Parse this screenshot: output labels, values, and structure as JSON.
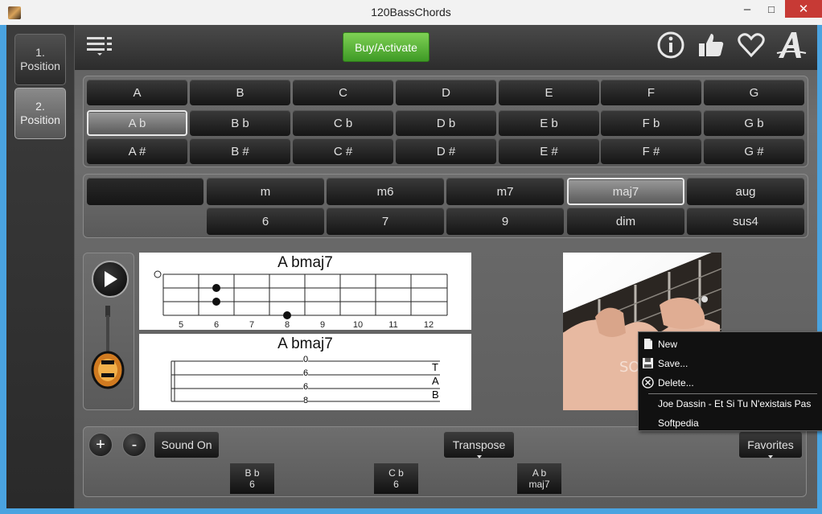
{
  "window": {
    "title": "120BassChords",
    "minimize": "–",
    "maximize": "□",
    "close": "✕"
  },
  "positions": [
    {
      "label_line1": "1.",
      "label_line2": "Position"
    },
    {
      "label_line1": "2.",
      "label_line2": "Position"
    }
  ],
  "toolbar": {
    "buy_label": "Buy/Activate",
    "icons": [
      "info-icon",
      "thumbs-up-icon",
      "heart-icon",
      "font-icon"
    ]
  },
  "notes": {
    "row1": [
      "A",
      "B",
      "C",
      "D",
      "E",
      "F",
      "G"
    ],
    "row2": [
      "A b",
      "B b",
      "C b",
      "D b",
      "E b",
      "F b",
      "G b"
    ],
    "row3": [
      "A #",
      "B #",
      "C #",
      "D #",
      "E #",
      "F #",
      "G #"
    ],
    "selected": "A b"
  },
  "chord_types": {
    "row1": [
      "m",
      "m6",
      "m7",
      "maj7",
      "aug"
    ],
    "row2": [
      "6",
      "7",
      "9",
      "dim",
      "sus4"
    ],
    "selected": "maj7"
  },
  "chord": {
    "fretboard_title": "A bmaj7",
    "fret_numbers": [
      "5",
      "6",
      "7",
      "8",
      "9",
      "10",
      "11",
      "12"
    ],
    "tab_title": "A bmaj7",
    "tab_values": [
      "0",
      "6",
      "6",
      "8"
    ],
    "tab_letters": [
      "T",
      "A",
      "B"
    ]
  },
  "photo": {
    "watermark": "SOFTPEDIA"
  },
  "bottom": {
    "plus": "+",
    "minus": "-",
    "sound_label": "Sound On",
    "transpose_label": "Transpose",
    "favorites_label": "Favorites",
    "chips": [
      {
        "note": "B b",
        "type": "6"
      },
      {
        "note": "C b",
        "type": "6"
      },
      {
        "note": "A b",
        "type": "maj7"
      }
    ]
  },
  "context_menu": {
    "items": [
      "New",
      "Save...",
      "Delete..."
    ],
    "favorites": [
      "Joe Dassin - Et Si Tu N'existais Pas",
      "Softpedia"
    ]
  }
}
